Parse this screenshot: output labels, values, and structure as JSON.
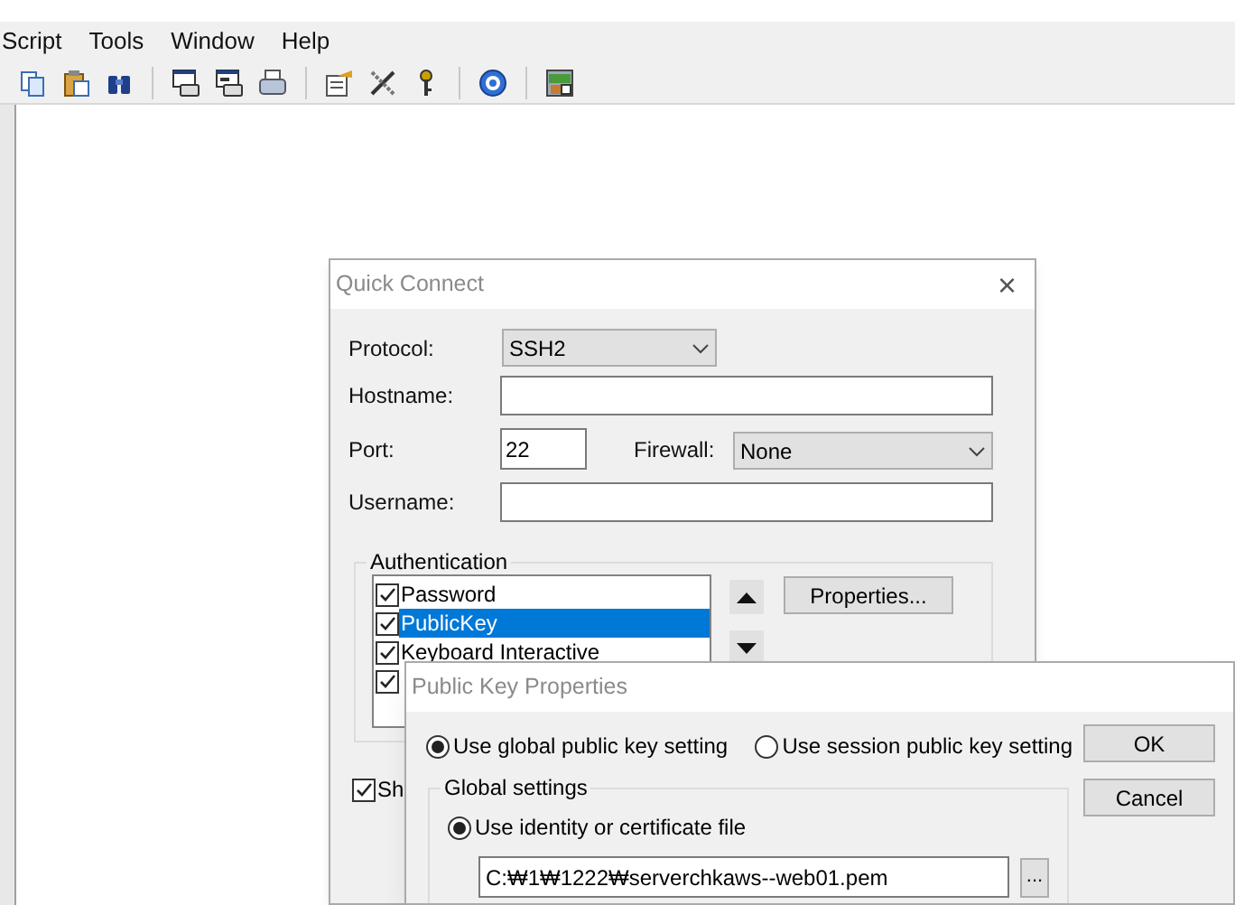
{
  "menu_bar": [
    "Script",
    "Tools",
    "Window",
    "Help"
  ],
  "quick_connect": {
    "title": "Quick Connect",
    "close": "×",
    "protocol": {
      "label": "Protocol:",
      "value": "SSH2"
    },
    "hostname": {
      "label": "Hostname:"
    },
    "port": {
      "label": "Port:",
      "value": "22"
    },
    "firewall": {
      "label": "Firewall:",
      "value": "None"
    },
    "username": {
      "label": "Username:"
    },
    "authentication": {
      "title": "Authentication",
      "items": [
        {
          "label": "Password",
          "checked": true,
          "selected": false
        },
        {
          "label": "PublicKey",
          "checked": true,
          "selected": true
        },
        {
          "label": "Keyboard Interactive",
          "checked": true,
          "selected": false
        },
        {
          "checked": true
        }
      ],
      "properties_button": "Properties..."
    },
    "show_checkbox": {
      "label": "Sh",
      "checked": true
    }
  },
  "public_key_properties": {
    "title": "Public Key Properties",
    "scope": [
      {
        "label": "Use global public key setting",
        "selected": true
      },
      {
        "label": "Use session public key setting",
        "selected": false
      }
    ],
    "buttons": [
      "OK",
      "Cancel"
    ],
    "global_settings": {
      "title": "Global settings",
      "source": {
        "label": "Use identity or certificate file",
        "selected": true
      },
      "file_path": "C:₩1₩1222₩serverchkaws--web01.pem",
      "browse_button": "..."
    }
  }
}
